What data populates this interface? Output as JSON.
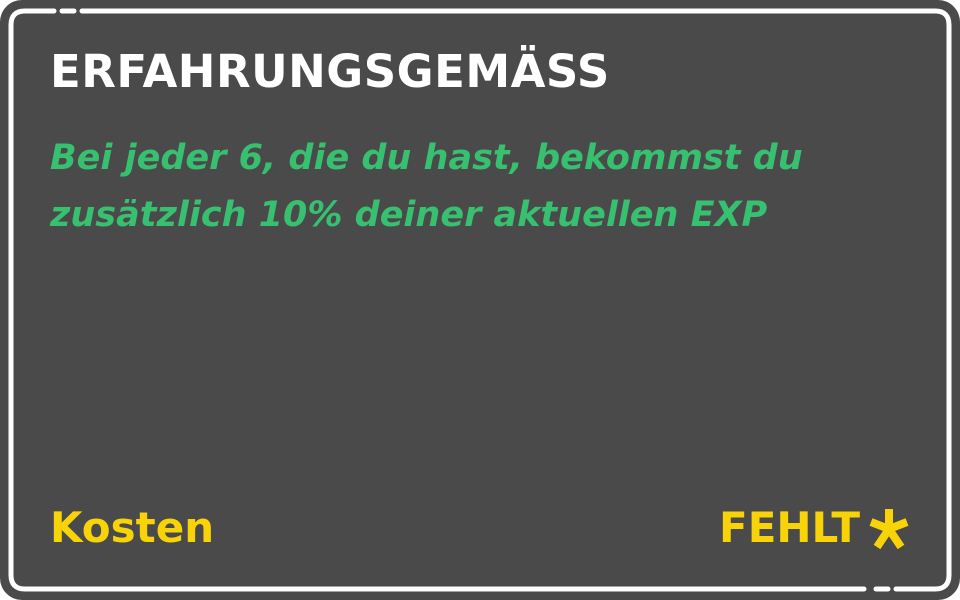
{
  "card": {
    "title": "ERFAHRUNGSGEMÄSS",
    "description": "Bei jeder 6, die du hast, bekommst du zusätzlich 10% deiner aktuellen EXP",
    "cost_label": "Kosten",
    "cost_value": "FEHLT",
    "cost_icon": "asterisk-icon"
  },
  "colors": {
    "card_background": "#4a4a4a",
    "border": "#ffffff",
    "title": "#ffffff",
    "description": "#36c06f",
    "cost": "#f7d307"
  }
}
